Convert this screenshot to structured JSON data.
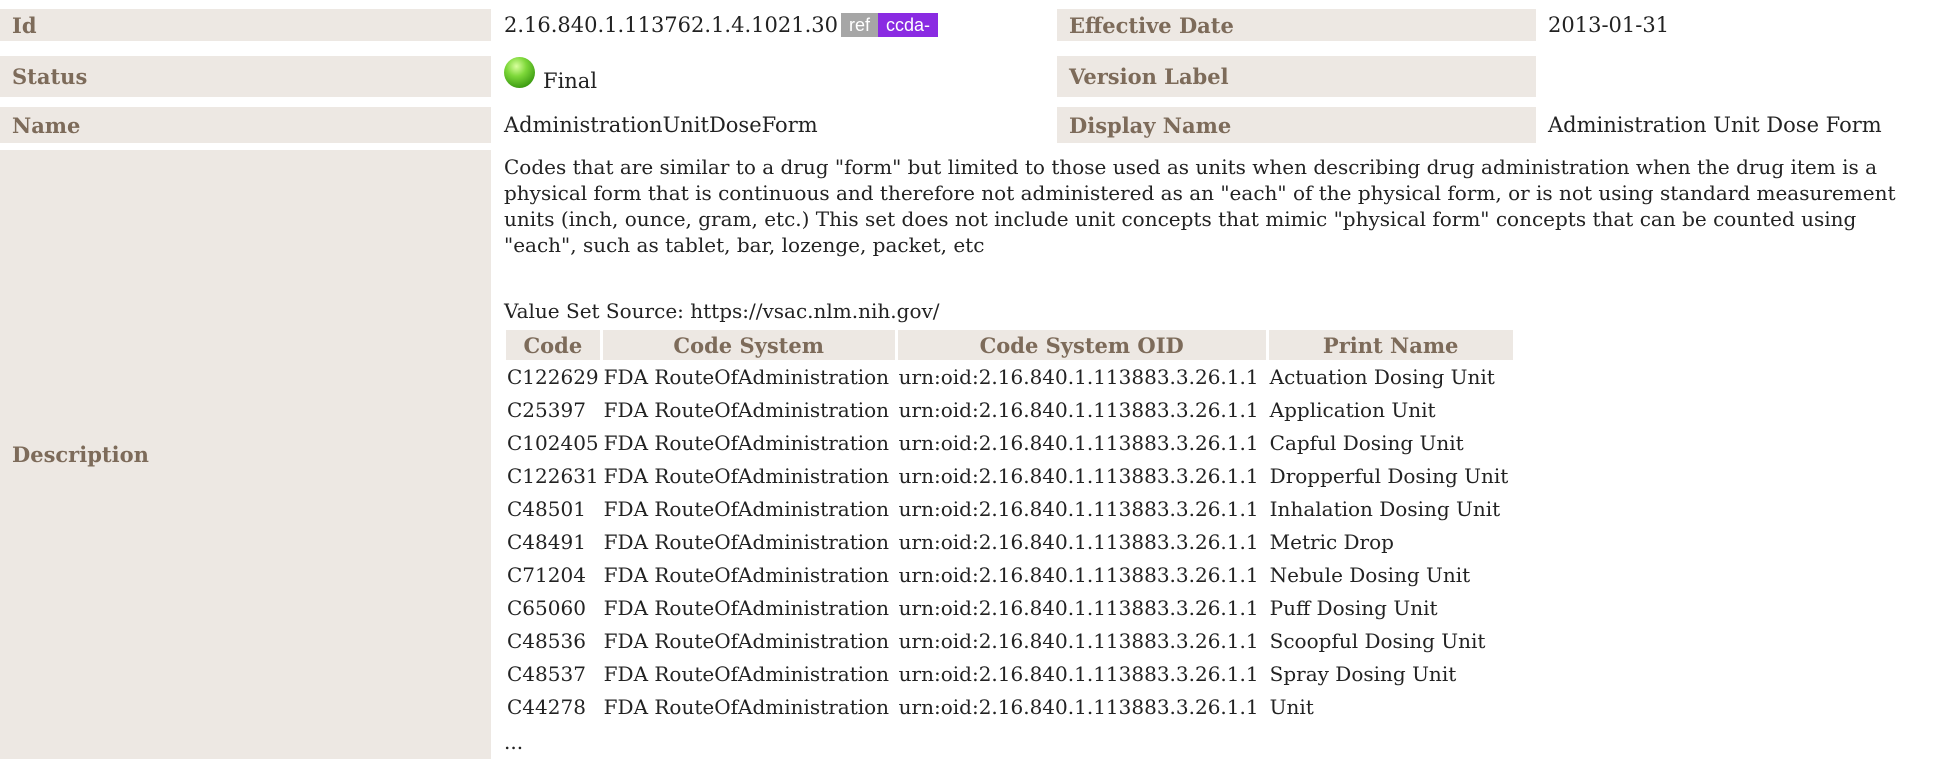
{
  "rows": {
    "id": {
      "label": "Id",
      "value": "2.16.840.1.113762.1.4.1021.30",
      "badge_ref": "ref",
      "badge_ccda": "ccda-",
      "label2": "Effective Date",
      "value2": "2013-01-31"
    },
    "status": {
      "label": "Status",
      "value": "Final",
      "label2": "Version Label",
      "value2": ""
    },
    "name": {
      "label": "Name",
      "value": "AdministrationUnitDoseForm",
      "label2": "Display Name",
      "value2": "Administration Unit Dose Form"
    },
    "description": {
      "label": "Description",
      "text": "Codes that are similar to a drug \"form\" but limited to those used as units when describing drug administration when the drug item is a physical form that is continuous and therefore not administered as an \"each\" of the physical form, or is not using standard measurement units (inch, ounce, gram, etc.) This set does not include unit concepts that mimic \"physical form\" concepts that can be counted using \"each\", such as tablet, bar, lozenge, packet, etc",
      "source": "Value Set Source: https://vsac.nlm.nih.gov/"
    }
  },
  "codes_table": {
    "headers": [
      "Code",
      "Code System",
      "Code System OID",
      "Print Name"
    ],
    "rows": [
      [
        "C122629",
        "FDA RouteOfAdministration",
        "urn:oid:2.16.840.1.113883.3.26.1.1",
        "Actuation Dosing Unit"
      ],
      [
        "C25397",
        "FDA RouteOfAdministration",
        "urn:oid:2.16.840.1.113883.3.26.1.1",
        "Application Unit"
      ],
      [
        "C102405",
        "FDA RouteOfAdministration",
        "urn:oid:2.16.840.1.113883.3.26.1.1",
        "Capful Dosing Unit"
      ],
      [
        "C122631",
        "FDA RouteOfAdministration",
        "urn:oid:2.16.840.1.113883.3.26.1.1",
        "Dropperful Dosing Unit"
      ],
      [
        "C48501",
        "FDA RouteOfAdministration",
        "urn:oid:2.16.840.1.113883.3.26.1.1",
        "Inhalation Dosing Unit"
      ],
      [
        "C48491",
        "FDA RouteOfAdministration",
        "urn:oid:2.16.840.1.113883.3.26.1.1",
        "Metric Drop"
      ],
      [
        "C71204",
        "FDA RouteOfAdministration",
        "urn:oid:2.16.840.1.113883.3.26.1.1",
        "Nebule Dosing Unit"
      ],
      [
        "C65060",
        "FDA RouteOfAdministration",
        "urn:oid:2.16.840.1.113883.3.26.1.1",
        "Puff Dosing Unit"
      ],
      [
        "C48536",
        "FDA RouteOfAdministration",
        "urn:oid:2.16.840.1.113883.3.26.1.1",
        "Scoopful Dosing Unit"
      ],
      [
        "C48537",
        "FDA RouteOfAdministration",
        "urn:oid:2.16.840.1.113883.3.26.1.1",
        "Spray Dosing Unit"
      ],
      [
        "C44278",
        "FDA RouteOfAdministration",
        "urn:oid:2.16.840.1.113883.3.26.1.1",
        "Unit"
      ]
    ],
    "more": "..."
  },
  "colors": {
    "label_bg": "#ede8e3",
    "label_text": "#7d6b5a",
    "badge_ref": "#a6a6a6",
    "badge_ccda": "#8a2be2",
    "status_final": "#5cbf2a"
  },
  "icons": {
    "status": "green-circle-icon"
  }
}
